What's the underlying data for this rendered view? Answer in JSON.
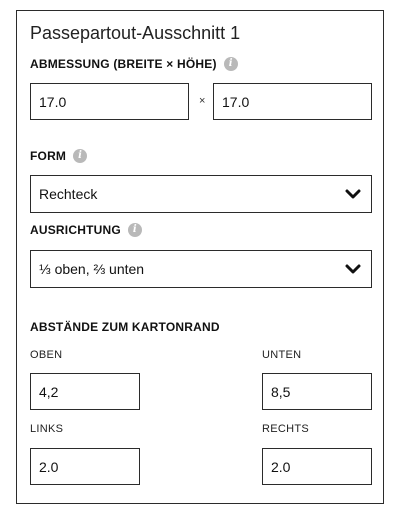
{
  "panel": {
    "title": "Passepartout-Ausschnitt 1"
  },
  "dimensions": {
    "label": "ABMESSUNG (BREITE × HÖHE)",
    "width_value": "17.0",
    "separator": "×",
    "height_value": "17.0"
  },
  "form": {
    "label": "FORM",
    "selected": "Rechteck"
  },
  "alignment": {
    "label": "AUSRICHTUNG",
    "selected": "⅓ oben, ⅔ unten"
  },
  "margins": {
    "label": "ABSTÄNDE ZUM KARTONRAND",
    "top_label": "OBEN",
    "top_value": "4,2",
    "bottom_label": "UNTEN",
    "bottom_value": "8,5",
    "left_label": "LINKS",
    "left_value": "2.0",
    "right_label": "RECHTS",
    "right_value": "2.0"
  },
  "icons": {
    "info": "info-icon",
    "dropdown": "chevron-down-icon"
  }
}
